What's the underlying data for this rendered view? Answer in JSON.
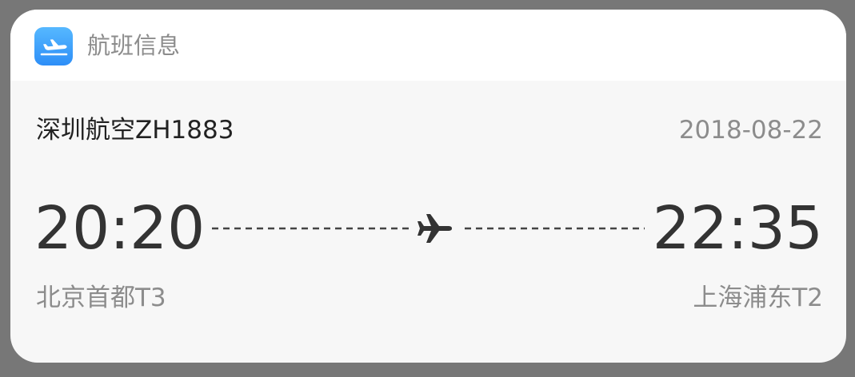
{
  "notification": {
    "app_icon": "airplane-icon",
    "app_name": "航班信息",
    "accent_color": "#3d9ff9"
  },
  "flight": {
    "name": "深圳航空ZH1883",
    "date": "2018-08-22",
    "departure": {
      "time": "20:20",
      "airport": "北京首都T3"
    },
    "arrival": {
      "time": "22:35",
      "airport": "上海浦东T2"
    },
    "route_icon": "airplane-icon"
  }
}
